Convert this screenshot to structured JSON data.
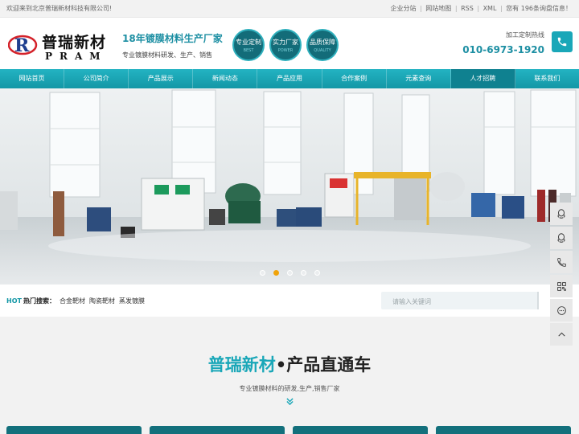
{
  "topbar": {
    "welcome": "欢迎来到北京普瑞新材科技有限公司!",
    "links": [
      "企业分站",
      "网站地图",
      "RSS",
      "XML",
      "您有 196条询盘信息！"
    ]
  },
  "header": {
    "logo_cn": "普瑞新材",
    "logo_en": "PRAM",
    "slogan_main": "18年镀膜材料生产厂家",
    "slogan_sub": "专业镀膜材料研发、生产、销售",
    "badges": [
      {
        "label": "专业定制",
        "sub": "BEST"
      },
      {
        "label": "实力厂家",
        "sub": "POWER"
      },
      {
        "label": "品质保障",
        "sub": "QUALITY"
      }
    ],
    "hotline_label": "加工定制热线",
    "hotline_number": "010-6973-1920"
  },
  "nav": {
    "items": [
      "网站首页",
      "公司简介",
      "产品展示",
      "新闻动态",
      "产品应用",
      "合作案例",
      "元素查询",
      "人才招聘",
      "联系我们"
    ],
    "active_index": 7
  },
  "banner": {
    "slide_count": 5,
    "active_slide": 1
  },
  "hot_search": {
    "hot": "HOT",
    "label": "热门搜索：",
    "keywords": [
      "合金靶材",
      "陶瓷靶材",
      "蒸发镀膜"
    ],
    "placeholder": "请输入关键词"
  },
  "products_section": {
    "title_accent": "普瑞新材",
    "title_dot": "•",
    "title_main": "产品直通车",
    "subtitle": "专业镀膜材料的研发,生产,销售厂家"
  },
  "colors": {
    "accent": "#1aa7b8",
    "nav_active": "#0f8190",
    "badge": "#136c79",
    "dot_active": "#f0a30a"
  },
  "float_bar": [
    "qq-icon",
    "qq-icon",
    "phone-icon",
    "qrcode-icon",
    "chat-icon",
    "back-to-top-icon"
  ]
}
